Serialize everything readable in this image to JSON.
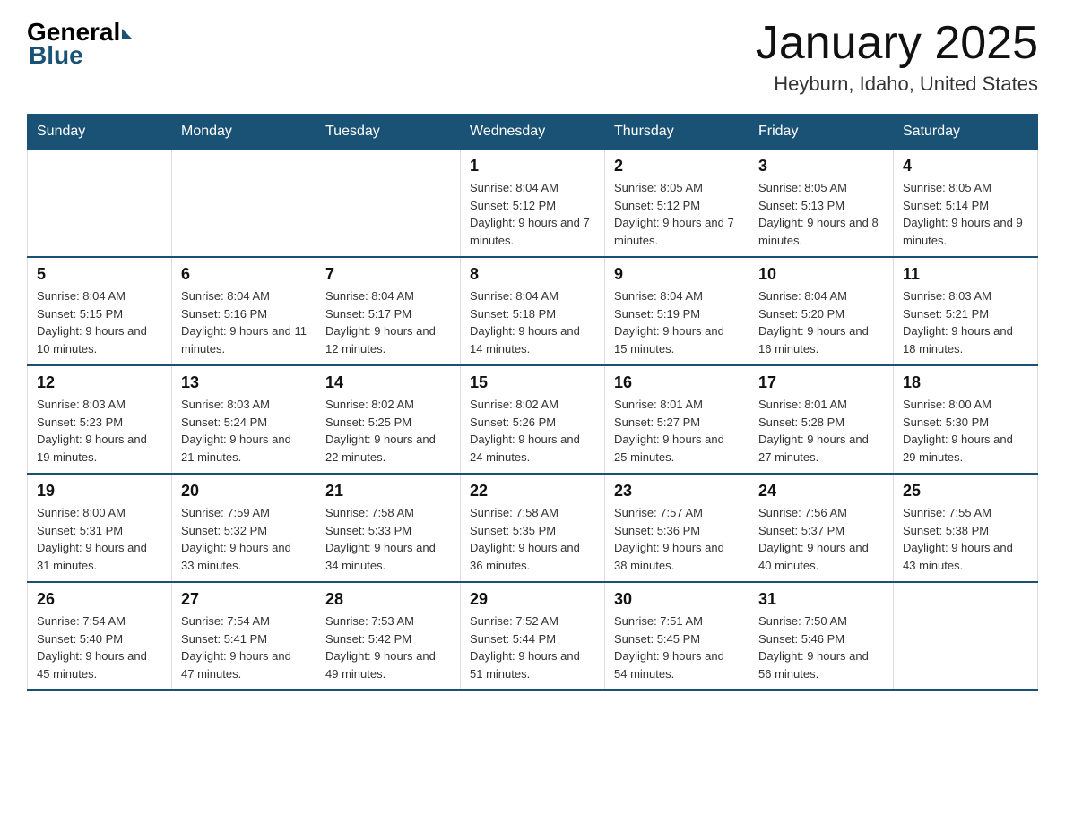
{
  "header": {
    "logo_general": "General",
    "logo_blue": "Blue",
    "title": "January 2025",
    "subtitle": "Heyburn, Idaho, United States"
  },
  "days_of_week": [
    "Sunday",
    "Monday",
    "Tuesday",
    "Wednesday",
    "Thursday",
    "Friday",
    "Saturday"
  ],
  "weeks": [
    [
      {
        "day": "",
        "info": ""
      },
      {
        "day": "",
        "info": ""
      },
      {
        "day": "",
        "info": ""
      },
      {
        "day": "1",
        "info": "Sunrise: 8:04 AM\nSunset: 5:12 PM\nDaylight: 9 hours and 7 minutes."
      },
      {
        "day": "2",
        "info": "Sunrise: 8:05 AM\nSunset: 5:12 PM\nDaylight: 9 hours and 7 minutes."
      },
      {
        "day": "3",
        "info": "Sunrise: 8:05 AM\nSunset: 5:13 PM\nDaylight: 9 hours and 8 minutes."
      },
      {
        "day": "4",
        "info": "Sunrise: 8:05 AM\nSunset: 5:14 PM\nDaylight: 9 hours and 9 minutes."
      }
    ],
    [
      {
        "day": "5",
        "info": "Sunrise: 8:04 AM\nSunset: 5:15 PM\nDaylight: 9 hours and 10 minutes."
      },
      {
        "day": "6",
        "info": "Sunrise: 8:04 AM\nSunset: 5:16 PM\nDaylight: 9 hours and 11 minutes."
      },
      {
        "day": "7",
        "info": "Sunrise: 8:04 AM\nSunset: 5:17 PM\nDaylight: 9 hours and 12 minutes."
      },
      {
        "day": "8",
        "info": "Sunrise: 8:04 AM\nSunset: 5:18 PM\nDaylight: 9 hours and 14 minutes."
      },
      {
        "day": "9",
        "info": "Sunrise: 8:04 AM\nSunset: 5:19 PM\nDaylight: 9 hours and 15 minutes."
      },
      {
        "day": "10",
        "info": "Sunrise: 8:04 AM\nSunset: 5:20 PM\nDaylight: 9 hours and 16 minutes."
      },
      {
        "day": "11",
        "info": "Sunrise: 8:03 AM\nSunset: 5:21 PM\nDaylight: 9 hours and 18 minutes."
      }
    ],
    [
      {
        "day": "12",
        "info": "Sunrise: 8:03 AM\nSunset: 5:23 PM\nDaylight: 9 hours and 19 minutes."
      },
      {
        "day": "13",
        "info": "Sunrise: 8:03 AM\nSunset: 5:24 PM\nDaylight: 9 hours and 21 minutes."
      },
      {
        "day": "14",
        "info": "Sunrise: 8:02 AM\nSunset: 5:25 PM\nDaylight: 9 hours and 22 minutes."
      },
      {
        "day": "15",
        "info": "Sunrise: 8:02 AM\nSunset: 5:26 PM\nDaylight: 9 hours and 24 minutes."
      },
      {
        "day": "16",
        "info": "Sunrise: 8:01 AM\nSunset: 5:27 PM\nDaylight: 9 hours and 25 minutes."
      },
      {
        "day": "17",
        "info": "Sunrise: 8:01 AM\nSunset: 5:28 PM\nDaylight: 9 hours and 27 minutes."
      },
      {
        "day": "18",
        "info": "Sunrise: 8:00 AM\nSunset: 5:30 PM\nDaylight: 9 hours and 29 minutes."
      }
    ],
    [
      {
        "day": "19",
        "info": "Sunrise: 8:00 AM\nSunset: 5:31 PM\nDaylight: 9 hours and 31 minutes."
      },
      {
        "day": "20",
        "info": "Sunrise: 7:59 AM\nSunset: 5:32 PM\nDaylight: 9 hours and 33 minutes."
      },
      {
        "day": "21",
        "info": "Sunrise: 7:58 AM\nSunset: 5:33 PM\nDaylight: 9 hours and 34 minutes."
      },
      {
        "day": "22",
        "info": "Sunrise: 7:58 AM\nSunset: 5:35 PM\nDaylight: 9 hours and 36 minutes."
      },
      {
        "day": "23",
        "info": "Sunrise: 7:57 AM\nSunset: 5:36 PM\nDaylight: 9 hours and 38 minutes."
      },
      {
        "day": "24",
        "info": "Sunrise: 7:56 AM\nSunset: 5:37 PM\nDaylight: 9 hours and 40 minutes."
      },
      {
        "day": "25",
        "info": "Sunrise: 7:55 AM\nSunset: 5:38 PM\nDaylight: 9 hours and 43 minutes."
      }
    ],
    [
      {
        "day": "26",
        "info": "Sunrise: 7:54 AM\nSunset: 5:40 PM\nDaylight: 9 hours and 45 minutes."
      },
      {
        "day": "27",
        "info": "Sunrise: 7:54 AM\nSunset: 5:41 PM\nDaylight: 9 hours and 47 minutes."
      },
      {
        "day": "28",
        "info": "Sunrise: 7:53 AM\nSunset: 5:42 PM\nDaylight: 9 hours and 49 minutes."
      },
      {
        "day": "29",
        "info": "Sunrise: 7:52 AM\nSunset: 5:44 PM\nDaylight: 9 hours and 51 minutes."
      },
      {
        "day": "30",
        "info": "Sunrise: 7:51 AM\nSunset: 5:45 PM\nDaylight: 9 hours and 54 minutes."
      },
      {
        "day": "31",
        "info": "Sunrise: 7:50 AM\nSunset: 5:46 PM\nDaylight: 9 hours and 56 minutes."
      },
      {
        "day": "",
        "info": ""
      }
    ]
  ]
}
